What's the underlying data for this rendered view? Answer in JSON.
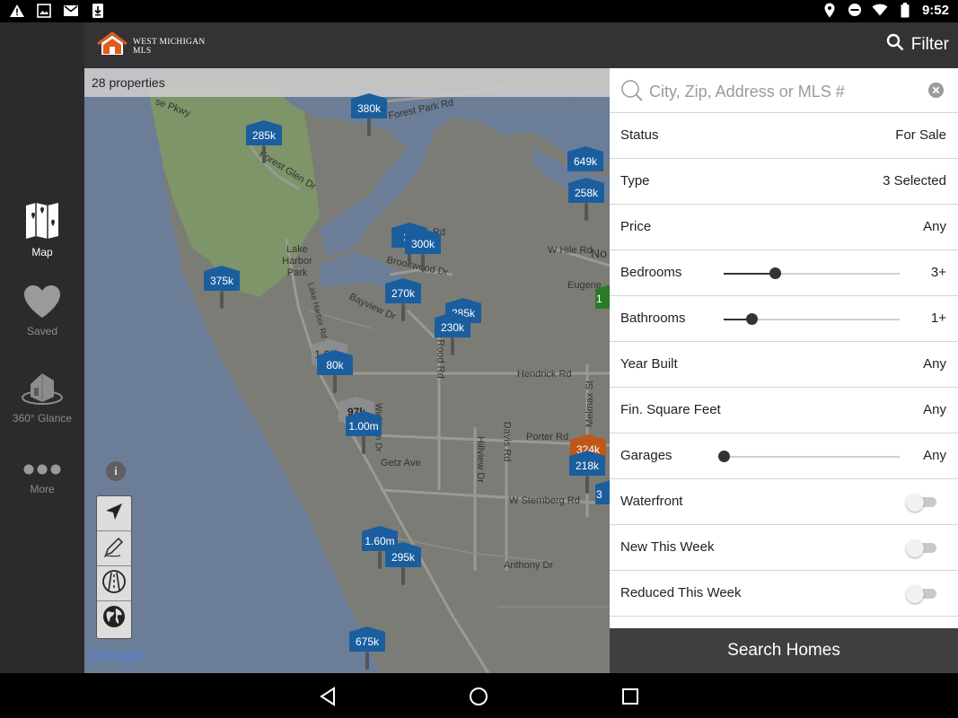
{
  "status_bar": {
    "time": "9:52"
  },
  "header": {
    "logo_line1": "WEST MICHIGAN",
    "logo_line2": "MLS",
    "filter_label": "Filter"
  },
  "sidebar": {
    "items": [
      {
        "label": "Map",
        "icon": "map-icon",
        "active": true
      },
      {
        "label": "Saved",
        "icon": "heart-icon",
        "active": false
      },
      {
        "label": "360° Glance",
        "icon": "house-360-icon",
        "active": false
      },
      {
        "label": "More",
        "icon": "more-dots-icon",
        "active": false
      }
    ]
  },
  "map": {
    "property_count": "28 properties",
    "attribution": "Google",
    "streets": [
      "Forest Park Rd",
      "Forest Glen Dr",
      "Lake Harbor Park",
      "se Pkwy",
      "Brookwood Dr",
      "Bayview Dr",
      "Lake Harbor Rd",
      "W Hile Rd",
      "Eugene",
      "Hendrick Rd",
      "Porter Rd",
      "Getz Ave",
      "Hillview Dr",
      "Davis Rd",
      "Melmax St",
      "W Sternberg Rd",
      "Anthony Dr",
      "Rood Rd",
      "Rd",
      "No",
      "Wickham Dr"
    ],
    "pins": [
      {
        "label": "380k",
        "color": "#1b5e9e"
      },
      {
        "label": "285k",
        "color": "#1b5e9e"
      },
      {
        "label": "649k",
        "color": "#1b5e9e"
      },
      {
        "label": "258k",
        "color": "#1b5e9e"
      },
      {
        "label": "37",
        "color": "#1b5e9e"
      },
      {
        "label": "300k",
        "color": "#1b5e9e"
      },
      {
        "label": "375k",
        "color": "#1b5e9e"
      },
      {
        "label": "270k",
        "color": "#1b5e9e"
      },
      {
        "label": "285k",
        "color": "#1b5e9e"
      },
      {
        "label": "230k",
        "color": "#1b5e9e"
      },
      {
        "label": "1.60m",
        "color": "#8d8d8d"
      },
      {
        "label": "80k",
        "color": "#1b5e9e"
      },
      {
        "label": "97k",
        "color": "#8d8d8d"
      },
      {
        "label": "1.00m",
        "color": "#1b5e9e"
      },
      {
        "label": "324k",
        "color": "#c0561a"
      },
      {
        "label": "218k",
        "color": "#1b5e9e"
      },
      {
        "label": "1.60m",
        "color": "#1b5e9e"
      },
      {
        "label": "295k",
        "color": "#1b5e9e"
      },
      {
        "label": "675k",
        "color": "#1b5e9e"
      },
      {
        "label": "3",
        "color": "#1b5e9e"
      },
      {
        "label": "1",
        "color": "#2a7a2a"
      }
    ],
    "tools": [
      "navigate-arrow-icon",
      "draw-pencil-icon",
      "road-view-icon",
      "globe-icon"
    ]
  },
  "filters": {
    "search_placeholder": "City, Zip, Address or MLS #",
    "rows": [
      {
        "label": "Status",
        "value": "For Sale",
        "kind": "value"
      },
      {
        "label": "Type",
        "value": "3 Selected",
        "kind": "value"
      },
      {
        "label": "Price",
        "value": "Any",
        "kind": "value"
      },
      {
        "label": "Bedrooms",
        "value": "3+",
        "kind": "slider",
        "level": 0.29
      },
      {
        "label": "Bathrooms",
        "value": "1+",
        "kind": "slider",
        "level": 0.16
      },
      {
        "label": "Year Built",
        "value": "Any",
        "kind": "value"
      },
      {
        "label": "Fin. Square Feet",
        "value": "Any",
        "kind": "value"
      },
      {
        "label": "Garages",
        "value": "Any",
        "kind": "slider",
        "level": 0.0
      },
      {
        "label": "Waterfront",
        "kind": "toggle",
        "on": false
      },
      {
        "label": "New This Week",
        "kind": "toggle",
        "on": false
      },
      {
        "label": "Reduced This Week",
        "kind": "toggle",
        "on": false
      }
    ],
    "search_button": "Search Homes"
  }
}
